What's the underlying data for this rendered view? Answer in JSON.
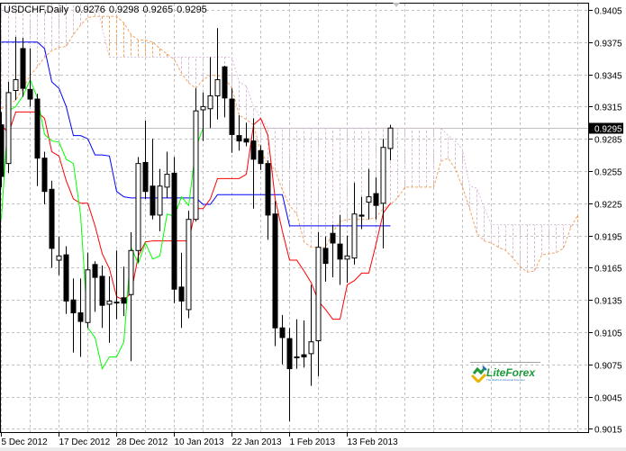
{
  "header": {
    "symbol": "USDCHF,Daily",
    "open": "0.9276",
    "high": "0.9298",
    "low": "0.9265",
    "close": "0.9295"
  },
  "logo": {
    "brand": "LiteForex",
    "tagline": "The World of Financial Freedom"
  },
  "colors": {
    "tenkan": "#ff0000",
    "kijun": "#0000ff",
    "chikou": "#00ff00",
    "senkou_a": "#f4a460",
    "senkou_b": "#d8bfd8",
    "grid": "#c0c0c0",
    "bid_line": "#c0c0c0"
  },
  "chart_data": {
    "type": "candlestick",
    "title": "USDCHF,Daily",
    "indicator": "Ichimoku Kinko Hyo",
    "ylim": [
      0.9015,
      0.9405
    ],
    "price_ticks": [
      "0.9405",
      "0.9375",
      "0.9345",
      "0.9315",
      "0.9285",
      "0.9255",
      "0.9225",
      "0.9195",
      "0.9165",
      "0.9135",
      "0.9105",
      "0.9075",
      "0.9045",
      "0.9015"
    ],
    "current_price": "0.9295",
    "date_labels": [
      {
        "bar": 0,
        "text": "5 Dec 2012"
      },
      {
        "bar": 8,
        "text": "17 Dec 2012"
      },
      {
        "bar": 16,
        "text": "28 Dec 2012"
      },
      {
        "bar": 24,
        "text": "10 Jan 2013"
      },
      {
        "bar": 32,
        "text": "22 Jan 2013"
      },
      {
        "bar": 40,
        "text": "1 Feb 2013"
      },
      {
        "bar": 48,
        "text": "13 Feb 2013"
      }
    ],
    "candles_ohlc": [
      [
        0.9298,
        0.931,
        0.924,
        0.925
      ],
      [
        0.9262,
        0.9338,
        0.9253,
        0.9328
      ],
      [
        0.933,
        0.938,
        0.9321,
        0.934
      ],
      [
        0.9369,
        0.9379,
        0.9324,
        0.9332
      ],
      [
        0.9331,
        0.9369,
        0.9315,
        0.9322
      ],
      [
        0.9322,
        0.9327,
        0.9241,
        0.9267
      ],
      [
        0.9267,
        0.9273,
        0.9224,
        0.9236
      ],
      [
        0.9238,
        0.9246,
        0.9165,
        0.9183
      ],
      [
        0.9172,
        0.9194,
        0.9158,
        0.9176
      ],
      [
        0.9177,
        0.9185,
        0.9122,
        0.9134
      ],
      [
        0.9135,
        0.9155,
        0.9086,
        0.9123
      ],
      [
        0.9123,
        0.9155,
        0.9082,
        0.9115
      ],
      [
        0.9114,
        0.9179,
        0.9109,
        0.9163
      ],
      [
        0.9168,
        0.9171,
        0.9124,
        0.9156
      ],
      [
        0.9157,
        0.9167,
        0.9109,
        0.913
      ],
      [
        0.9131,
        0.9157,
        0.9095,
        0.9134
      ],
      [
        0.9133,
        0.9181,
        0.9117,
        0.9133
      ],
      [
        0.9137,
        0.9166,
        0.912,
        0.9132
      ],
      [
        0.914,
        0.9198,
        0.9078,
        0.9181
      ],
      [
        0.9181,
        0.9268,
        0.917,
        0.9262
      ],
      [
        0.9263,
        0.9302,
        0.9229,
        0.9236
      ],
      [
        0.9241,
        0.9285,
        0.921,
        0.9214
      ],
      [
        0.9214,
        0.9257,
        0.9199,
        0.9241
      ],
      [
        0.924,
        0.9273,
        0.923,
        0.9252
      ],
      [
        0.9253,
        0.9268,
        0.9132,
        0.9145
      ],
      [
        0.9147,
        0.9179,
        0.9109,
        0.9134
      ],
      [
        0.9126,
        0.9218,
        0.9118,
        0.921
      ],
      [
        0.921,
        0.9332,
        0.9208,
        0.9311
      ],
      [
        0.9312,
        0.9328,
        0.9283,
        0.9315
      ],
      [
        0.9313,
        0.9361,
        0.9295,
        0.9325
      ],
      [
        0.9325,
        0.9388,
        0.9303,
        0.934
      ],
      [
        0.9352,
        0.9353,
        0.9305,
        0.9323
      ],
      [
        0.9322,
        0.9332,
        0.9272,
        0.9289
      ],
      [
        0.9288,
        0.9307,
        0.9274,
        0.9283
      ],
      [
        0.9285,
        0.93,
        0.9278,
        0.9282
      ],
      [
        0.9283,
        0.9304,
        0.922,
        0.9266
      ],
      [
        0.9274,
        0.9279,
        0.9256,
        0.9262
      ],
      [
        0.9262,
        0.9265,
        0.9191,
        0.9214
      ],
      [
        0.9215,
        0.9227,
        0.9092,
        0.9109
      ],
      [
        0.9109,
        0.9121,
        0.9075,
        0.91
      ],
      [
        0.9099,
        0.9109,
        0.9022,
        0.9071
      ],
      [
        0.9082,
        0.9117,
        0.9071,
        0.9082
      ],
      [
        0.9084,
        0.9116,
        0.9072,
        0.9082
      ],
      [
        0.9085,
        0.9149,
        0.9055,
        0.9096
      ],
      [
        0.9097,
        0.9198,
        0.9064,
        0.9184
      ],
      [
        0.9183,
        0.9194,
        0.9152,
        0.9169
      ],
      [
        0.9197,
        0.9205,
        0.9156,
        0.9188
      ],
      [
        0.9187,
        0.9214,
        0.9149,
        0.9173
      ],
      [
        0.9173,
        0.9195,
        0.9151,
        0.9176
      ],
      [
        0.9174,
        0.9244,
        0.9168,
        0.9215
      ],
      [
        0.9214,
        0.9231,
        0.9201,
        0.9213
      ],
      [
        0.9226,
        0.9257,
        0.921,
        0.9231
      ],
      [
        0.9234,
        0.9249,
        0.921,
        0.9223
      ],
      [
        0.9225,
        0.9285,
        0.9183,
        0.9277
      ],
      [
        0.9276,
        0.9298,
        0.9265,
        0.9295
      ]
    ],
    "tenkan": [
      0.9298,
      0.929,
      0.931,
      0.931,
      0.931,
      0.931,
      0.9304,
      0.9273,
      0.9269,
      0.9246,
      0.9229,
      0.9225,
      0.9225,
      0.9204,
      0.9178,
      0.9164,
      0.9138,
      0.9135,
      0.9141,
      0.9176,
      0.9189,
      0.919,
      0.919,
      0.919,
      0.919,
      0.919,
      0.919,
      0.922,
      0.922,
      0.9229,
      0.9248,
      0.9248,
      0.9248,
      0.9248,
      0.9252,
      0.9298,
      0.9304,
      0.9288,
      0.9229,
      0.9199,
      0.9172,
      0.9172,
      0.9162,
      0.9151,
      0.9134,
      0.9126,
      0.9117,
      0.9117,
      0.9149,
      0.9153,
      0.916,
      0.916,
      0.9187,
      0.9216,
      0.9225
    ],
    "kijun": [
      0.9375,
      0.9375,
      0.9375,
      0.9375,
      0.9375,
      0.9375,
      0.9369,
      0.9338,
      0.9332,
      0.9315,
      0.9288,
      0.9288,
      0.9285,
      0.927,
      0.927,
      0.9269,
      0.9236,
      0.9231,
      0.923,
      0.923,
      0.923,
      0.923,
      0.923,
      0.923,
      0.923,
      0.923,
      0.923,
      0.923,
      0.9224,
      0.9224,
      0.9233,
      0.9233,
      0.9233,
      0.9233,
      0.9233,
      0.9233,
      0.9233,
      0.9233,
      0.9233,
      0.9233,
      0.9204,
      0.9204,
      0.9204,
      0.9204,
      0.9204,
      0.9204,
      0.9204,
      0.9204,
      0.9204,
      0.9204,
      0.9204,
      0.9204,
      0.9204,
      0.9204,
      0.9204
    ],
    "chikou_shift": 26,
    "senkou_a": [
      0.9313,
      0.9317,
      0.9321,
      0.9332,
      0.9344,
      0.9352,
      0.9361,
      0.9367,
      0.937,
      0.9371,
      0.9382,
      0.9391,
      0.9398,
      0.9399,
      0.9399,
      0.9399,
      0.9399,
      0.9393,
      0.9382,
      0.9377,
      0.9377,
      0.9375,
      0.9369,
      0.9364,
      0.9359,
      0.9346,
      0.9337,
      0.9332,
      0.934,
      0.9344,
      0.9344,
      0.9342,
      0.9332,
      0.9307,
      0.9303,
      0.9298,
      0.9273,
      0.9262,
      0.9256,
      0.9237,
      0.9223,
      0.9215,
      0.9189,
      0.9184,
      0.9184,
      0.9184,
      0.9198,
      0.9208,
      0.921,
      0.921,
      0.921,
      0.921,
      0.9212,
      0.922,
      0.9224,
      0.923,
      0.924,
      0.924,
      0.924,
      0.924,
      0.924,
      0.9264,
      0.9267,
      0.9257,
      0.924,
      0.922,
      0.9197,
      0.919,
      0.9188,
      0.9184,
      0.9181,
      0.9174,
      0.9166,
      0.9161,
      0.9162,
      0.9177,
      0.9178,
      0.9179,
      0.9183,
      0.9202,
      0.9214
    ],
    "senkou_b": [
      0.942,
      0.942,
      0.942,
      0.942,
      0.942,
      0.942,
      0.942,
      0.942,
      0.942,
      0.942,
      0.942,
      0.942,
      0.942,
      0.942,
      0.9388,
      0.9361,
      0.9361,
      0.9361,
      0.9361,
      0.9361,
      0.9361,
      0.9361,
      0.9361,
      0.9361,
      0.9361,
      0.9361,
      0.9361,
      0.9361,
      0.9361,
      0.9361,
      0.9361,
      0.9361,
      0.9361,
      0.9338,
      0.9334,
      0.9315,
      0.9304,
      0.9295,
      0.9295,
      0.9295,
      0.9295,
      0.9295,
      0.9295,
      0.9295,
      0.9295,
      0.9295,
      0.9295,
      0.9295,
      0.9295,
      0.9295,
      0.9295,
      0.9295,
      0.9295,
      0.9295,
      0.9295,
      0.9295,
      0.9295,
      0.9295,
      0.9295,
      0.9295,
      0.9295,
      0.9295,
      0.9288,
      0.9283,
      0.9275,
      0.9241,
      0.9239,
      0.9221,
      0.9205,
      0.9205,
      0.9205,
      0.9205,
      0.9205,
      0.9205,
      0.9205,
      0.9205,
      0.9205,
      0.9205,
      0.9205,
      0.9205,
      0.9205
    ]
  }
}
